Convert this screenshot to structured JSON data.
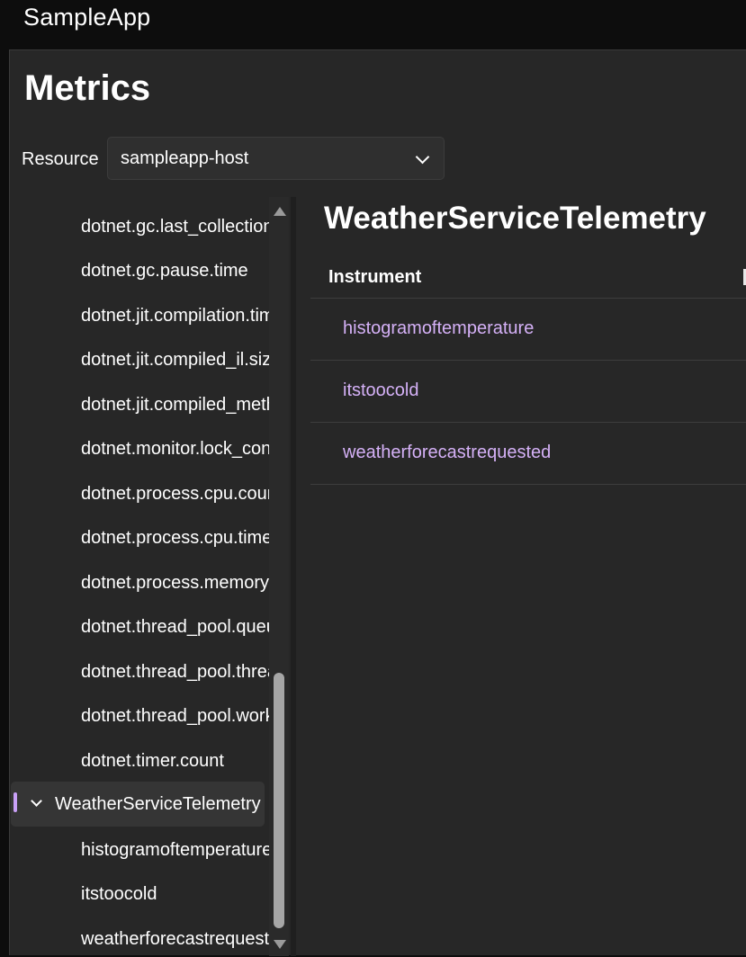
{
  "app": {
    "title": "SampleApp"
  },
  "page": {
    "title": "Metrics"
  },
  "resource": {
    "label": "Resource",
    "selected": "sampleapp-host"
  },
  "tree": {
    "items": [
      "dotnet.gc.last_collection",
      "dotnet.gc.pause.time",
      "dotnet.jit.compilation.time",
      "dotnet.jit.compiled_il.size",
      "dotnet.jit.compiled_methods",
      "dotnet.monitor.lock_contentions",
      "dotnet.process.cpu.count",
      "dotnet.process.cpu.time",
      "dotnet.process.memory",
      "dotnet.thread_pool.queue",
      "dotnet.thread_pool.thread",
      "dotnet.thread_pool.work",
      "dotnet.timer.count"
    ],
    "group": {
      "label": "WeatherServiceTelemetry",
      "children": [
        "histogramoftemperature",
        "itstoocold",
        "weatherforecastrequested"
      ]
    }
  },
  "detail": {
    "title": "WeatherServiceTelemetry",
    "table": {
      "header": "Instrument",
      "rows": [
        "histogramoftemperature",
        "itstoocold",
        "weatherforecastrequested"
      ]
    }
  },
  "colors": {
    "accent": "#c9a0f7",
    "link": "#d5b1f7",
    "background": "#272727"
  }
}
